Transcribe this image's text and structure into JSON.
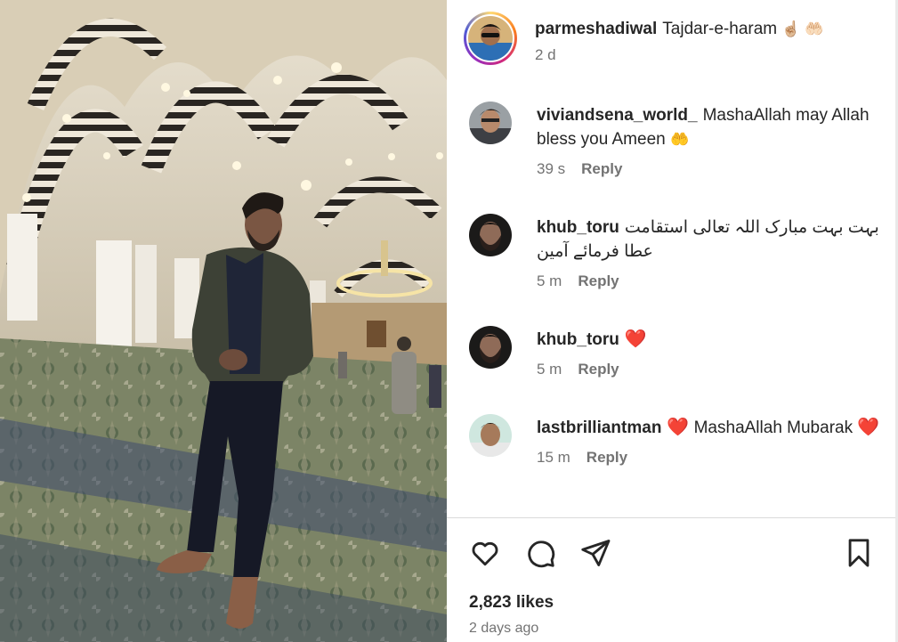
{
  "post": {
    "author": "parmeshadiwal",
    "caption": "Tajdar-e-haram",
    "caption_emoji": "☝🏼 🤲🏻",
    "age": "2 d",
    "likes": "2,823 likes",
    "posted": "2 days ago"
  },
  "comments": [
    {
      "username": "viviandsena_world_",
      "text": "MashaAllah may Allah bless you Ameen",
      "emoji": "🤲",
      "time": "39 s",
      "reply": "Reply",
      "avatar_icon": "profile-photo-man-glasses"
    },
    {
      "username": "khub_toru",
      "text": "بہت بہت مبارک اللہ تعالی استقامت عطا فرمائے آمین",
      "time": "5 m",
      "reply": "Reply",
      "avatar_icon": "profile-photo-bearded-man"
    },
    {
      "username": "khub_toru",
      "text": "❤️",
      "time": "5 m",
      "reply": "Reply",
      "avatar_icon": "profile-photo-bearded-man"
    },
    {
      "username": "lastbrilliantman",
      "text": "MashaAllah Mubarak",
      "time": "15 m",
      "reply": "Reply",
      "avatar_icon": "profile-photo-man-teal"
    }
  ],
  "actions": {
    "like_icon": "heart-outline-icon",
    "comment_icon": "speech-bubble-icon",
    "share_icon": "paper-plane-icon",
    "save_icon": "bookmark-icon"
  },
  "colors": {
    "text_primary": "#262626",
    "text_secondary": "#737373",
    "heart": "#ff3040",
    "divider": "#dbdbdb"
  }
}
